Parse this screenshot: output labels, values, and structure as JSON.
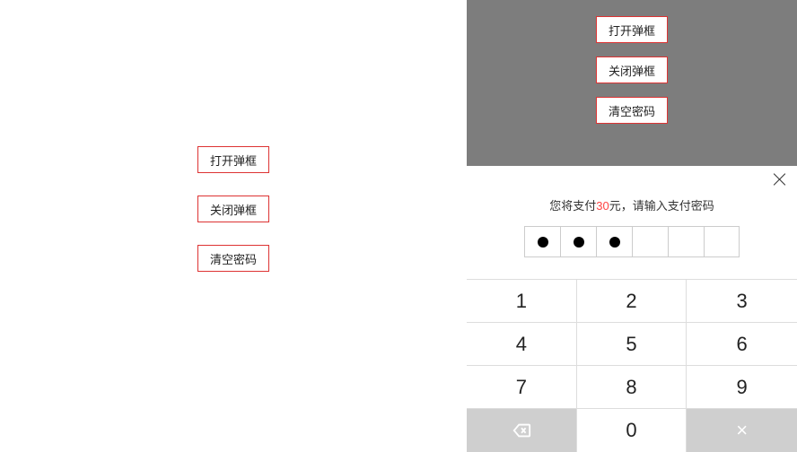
{
  "buttons": {
    "open": "打开弹框",
    "close": "关闭弹框",
    "clear": "清空密码"
  },
  "popup": {
    "prompt_pre": "您将支付",
    "amount": "30",
    "prompt_mid": "元，请输入支付密码",
    "entered_count": 3,
    "total_count": 6
  },
  "keypad": {
    "keys": [
      "1",
      "2",
      "3",
      "4",
      "5",
      "6",
      "7",
      "8",
      "9"
    ],
    "zero": "0",
    "del_icon": "backspace-icon",
    "confirm_icon": "x-icon"
  }
}
